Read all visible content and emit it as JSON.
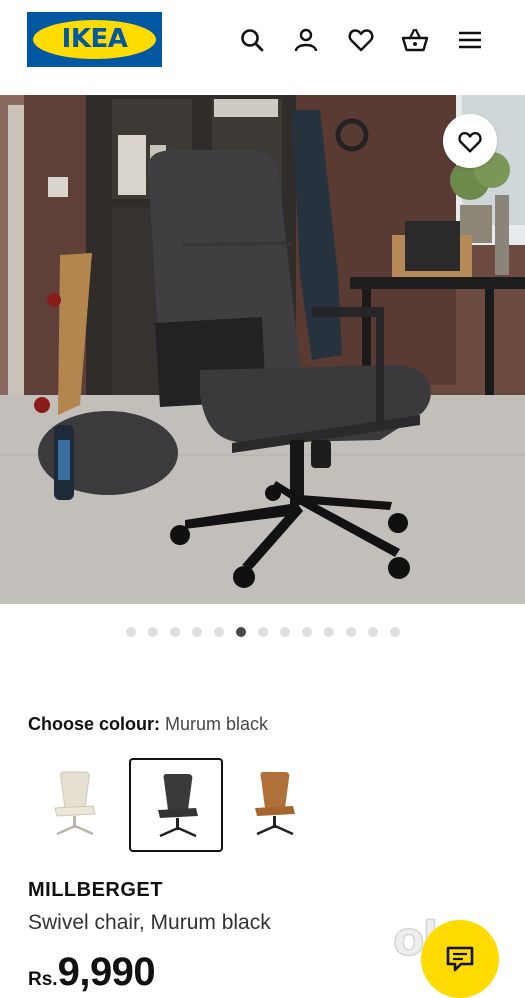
{
  "header": {
    "logo_text": "IKEA",
    "icons": [
      "search-icon",
      "account-icon",
      "heart-icon",
      "basket-icon",
      "menu-icon"
    ]
  },
  "gallery": {
    "total_images": 13,
    "active_index": 5,
    "favourite_icon": "heart-icon"
  },
  "colour": {
    "label": "Choose colour:",
    "selected": "Murum black",
    "options": [
      {
        "name": "beige",
        "color": "#e6e0d2"
      },
      {
        "name": "Murum black",
        "color": "#3a3a3a"
      },
      {
        "name": "brown",
        "color": "#b0703a"
      }
    ]
  },
  "product": {
    "name": "MILLBERGET",
    "description": "Swivel chair, Murum black",
    "currency": "Rs.",
    "price": "9,990"
  },
  "overlay": {
    "watermark": "olx",
    "chat_icon": "chat-icon"
  },
  "colors": {
    "ikea_blue": "#0058a3",
    "ikea_yellow": "#ffdb00",
    "dot_active": "#484848",
    "dot_inactive": "#dfdfdf"
  }
}
